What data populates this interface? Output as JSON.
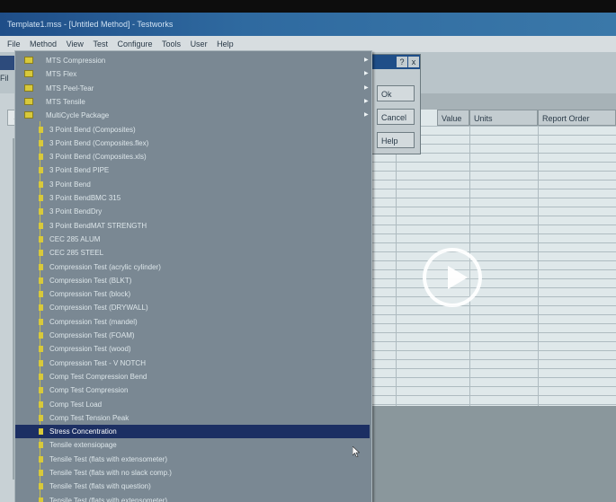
{
  "window": {
    "title": "Template1.mss - [Untitled Method] - Testworks"
  },
  "menubar": {
    "items": [
      "File",
      "Method",
      "View",
      "Test",
      "Configure",
      "Tools",
      "User",
      "Help"
    ]
  },
  "toolbar": {
    "file_label": "Fil"
  },
  "left_tab": {
    "label": "A"
  },
  "dialog": {
    "help_label": "?",
    "close_label": "x",
    "ok_label": "Ok",
    "cancel_label": "Cancel",
    "help_button_label": "Help"
  },
  "grid": {
    "headers": [
      "Value",
      "Units",
      "Report Order"
    ]
  },
  "menu": {
    "items": [
      {
        "label": "MTS Compression",
        "submenu": true
      },
      {
        "label": "MTS Flex",
        "submenu": true
      },
      {
        "label": "MTS Peel-Tear",
        "submenu": true
      },
      {
        "label": "MTS Tensile",
        "submenu": true
      },
      {
        "label": "MultiCycle Package",
        "submenu": true
      },
      {
        "label": "3 Point Bend (Composites)"
      },
      {
        "label": "3 Point Bend (Composites.flex)"
      },
      {
        "label": "3 Point Bend (Composites.xls)"
      },
      {
        "label": "3 Point Bend PIPE"
      },
      {
        "label": "3 Point Bend"
      },
      {
        "label": "3 Point BendBMC 315"
      },
      {
        "label": "3 Point BendDry"
      },
      {
        "label": "3 Point BendMAT STRENGTH"
      },
      {
        "label": "CEC 285 ALUM"
      },
      {
        "label": "CEC 285 STEEL"
      },
      {
        "label": "Compression Test (acrylic cylinder)"
      },
      {
        "label": "Compression Test (BLKT)"
      },
      {
        "label": "Compression Test (block)"
      },
      {
        "label": "Compression Test (DRYWALL)"
      },
      {
        "label": "Compression Test (mandel)"
      },
      {
        "label": "Compression Test (FOAM)"
      },
      {
        "label": "Compression Test (wood)"
      },
      {
        "label": "Compression Test - V NOTCH"
      },
      {
        "label": "Comp Test Compression Bend"
      },
      {
        "label": "Comp Test Compression"
      },
      {
        "label": "Comp Test Load"
      },
      {
        "label": "Comp Test Tension Peak"
      },
      {
        "label": "Stress Concentration",
        "highlighted": true
      },
      {
        "label": "Tensile extensiopage"
      },
      {
        "label": "Tensile Test (flats with extensometer)"
      },
      {
        "label": "Tensile Test (flats with no slack comp.)"
      },
      {
        "label": "Tensile Test (flats with question)"
      },
      {
        "label": "Tensile Test (flats with extensometer)"
      }
    ]
  },
  "icons": {
    "folder": "folder-icon",
    "document": "document-icon",
    "submenu": "submenu-arrow-icon",
    "play": "play-icon",
    "cursor": "mouse-pointer-icon"
  },
  "colors": {
    "menu_bg": "#7a8893",
    "highlight": "#1c2f63",
    "title_bar": "#1f4e88",
    "grid_bg": "#dfe8ea",
    "folder": "#d8c93a"
  }
}
